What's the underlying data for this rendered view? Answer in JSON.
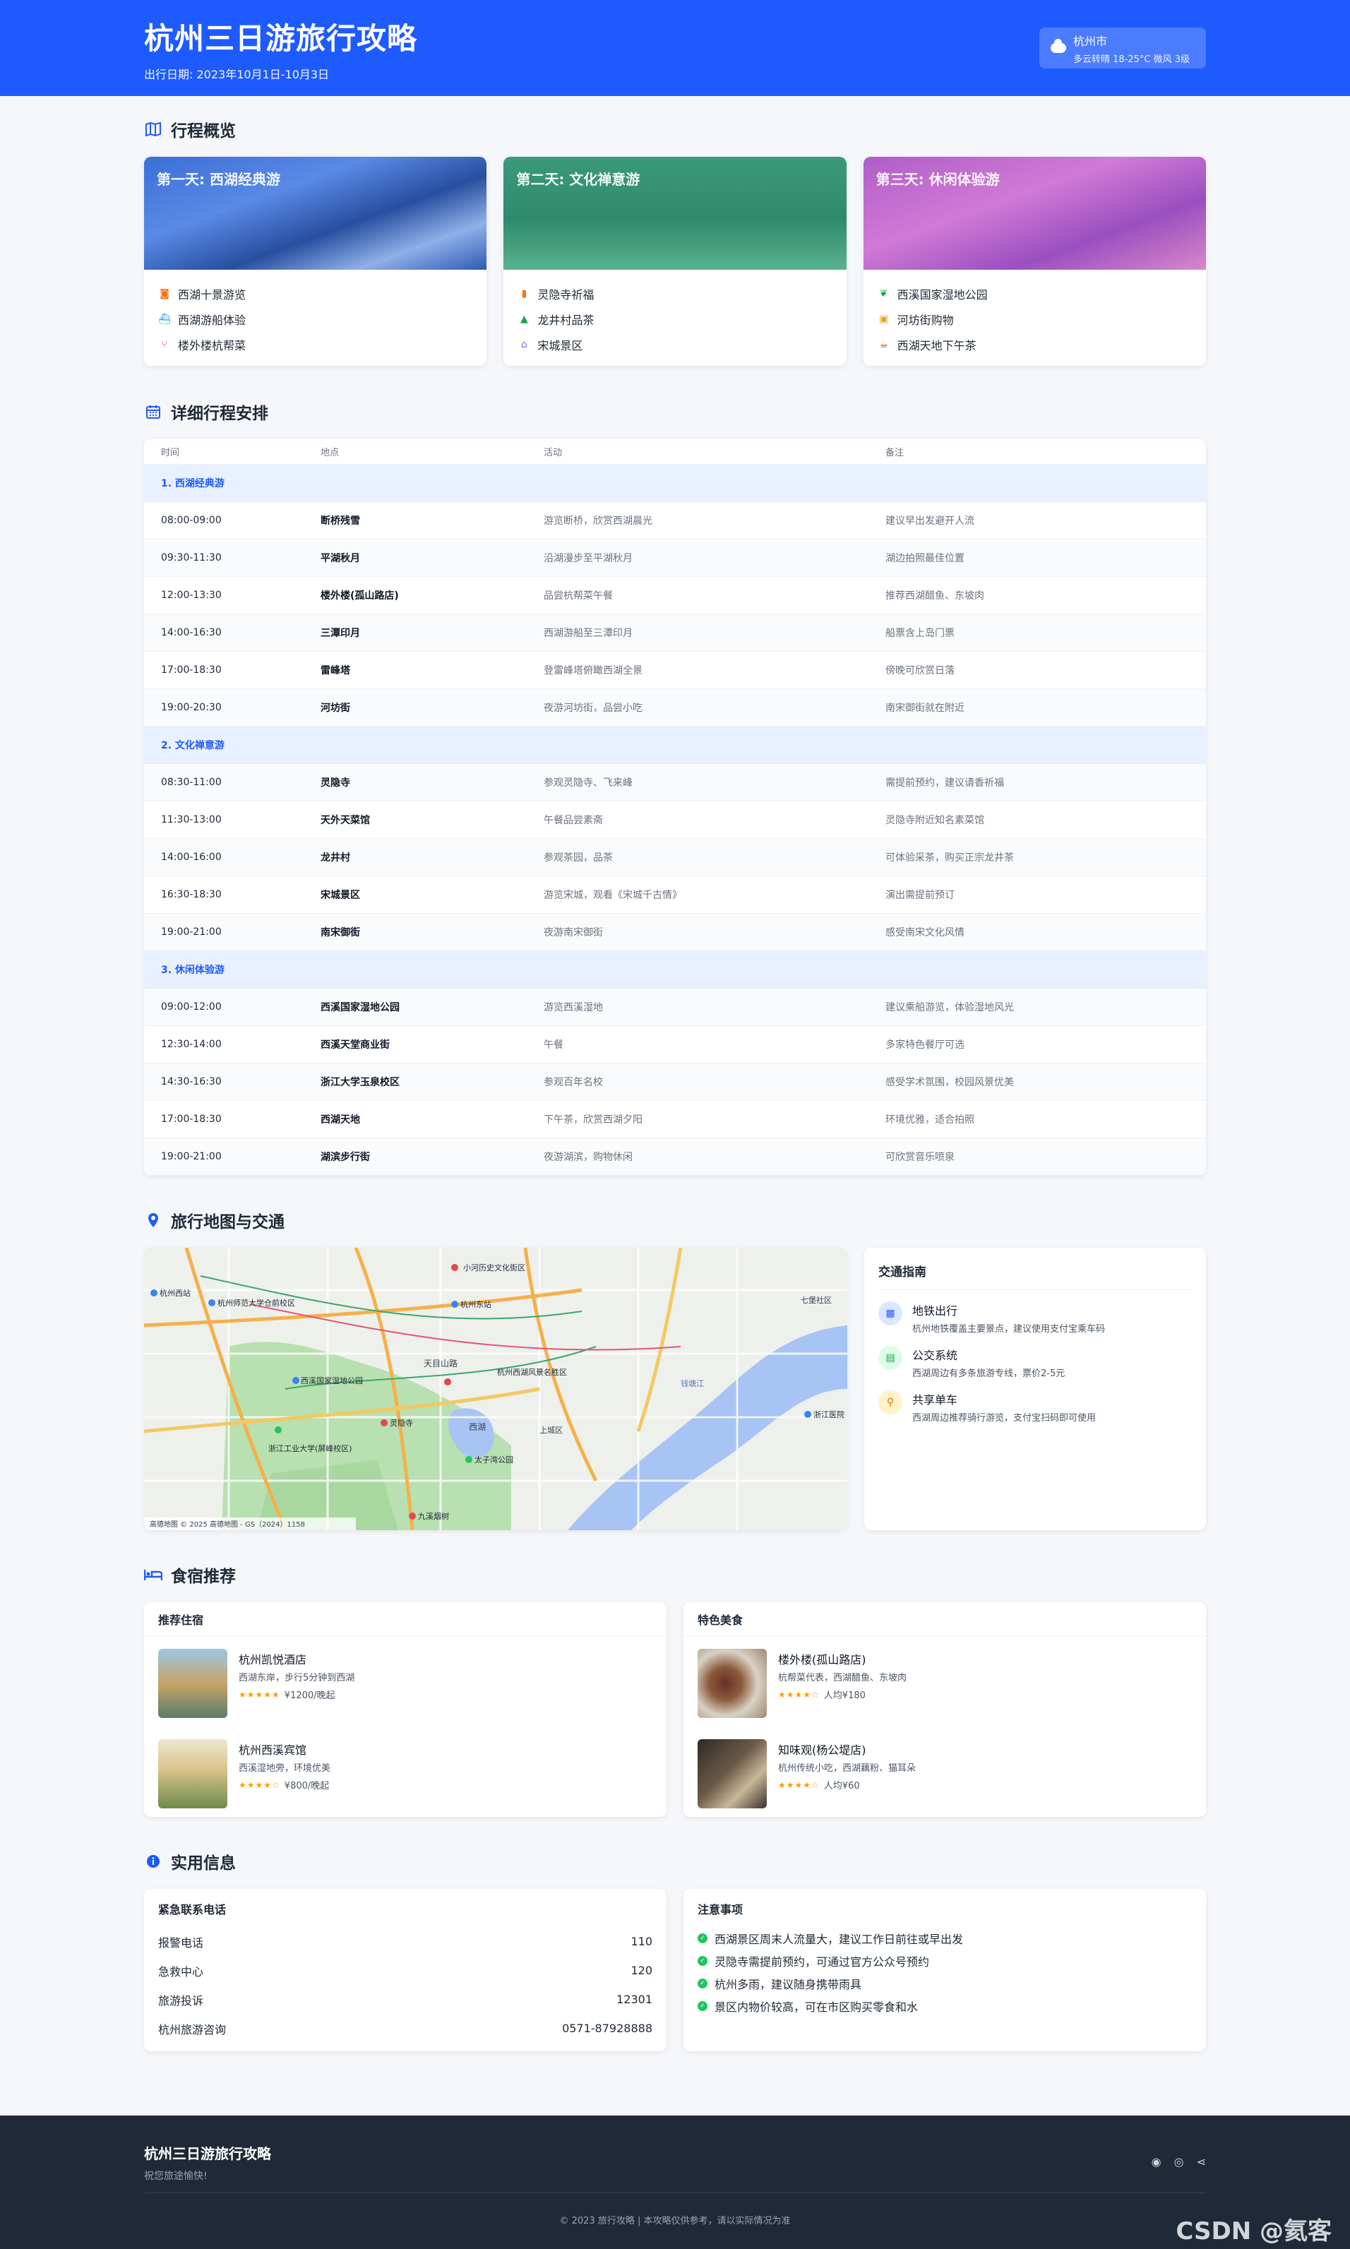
{
  "header": {
    "title": "杭州三日游旅行攻略",
    "subtitle": "出行日期: 2023年10月1日-10月3日",
    "weather": {
      "city": "杭州市",
      "desc": "多云转晴 18-25°C 微风 3级"
    }
  },
  "overview": {
    "title": "行程概览",
    "cards": [
      {
        "label": "第一天: 西湖经典游",
        "items": [
          "西湖十景游览",
          "西湖游船体验",
          "楼外楼杭帮菜"
        ],
        "icons": [
          "camera-icon",
          "ship-icon",
          "utensils-icon"
        ]
      },
      {
        "label": "第二天: 文化禅意游",
        "items": [
          "灵隐寺祈福",
          "龙井村品茶",
          "宋城景区"
        ],
        "icons": [
          "book-icon",
          "tree-icon",
          "temple-icon"
        ]
      },
      {
        "label": "第三天: 休闲体验游",
        "items": [
          "西溪国家湿地公园",
          "河坊街购物",
          "西湖天地下午茶"
        ],
        "icons": [
          "leaf-icon",
          "shopping-bag-icon",
          "coffee-icon"
        ]
      }
    ]
  },
  "schedule": {
    "title": "详细行程安排",
    "columns": [
      "时间",
      "地点",
      "活动",
      "备注"
    ],
    "groups": [
      {
        "name": "1. 西湖经典游",
        "rows": [
          [
            "08:00-09:00",
            "断桥残雪",
            "游览断桥，欣赏西湖晨光",
            "建议早出发避开人流"
          ],
          [
            "09:30-11:30",
            "平湖秋月",
            "沿湖漫步至平湖秋月",
            "湖边拍照最佳位置"
          ],
          [
            "12:00-13:30",
            "楼外楼(孤山路店)",
            "品尝杭帮菜午餐",
            "推荐西湖醋鱼、东坡肉"
          ],
          [
            "14:00-16:30",
            "三潭印月",
            "西湖游船至三潭印月",
            "船票含上岛门票"
          ],
          [
            "17:00-18:30",
            "雷峰塔",
            "登雷峰塔俯瞰西湖全景",
            "傍晚可欣赏日落"
          ],
          [
            "19:00-20:30",
            "河坊街",
            "夜游河坊街，品尝小吃",
            "南宋御街就在附近"
          ]
        ]
      },
      {
        "name": "2. 文化禅意游",
        "rows": [
          [
            "08:30-11:00",
            "灵隐寺",
            "参观灵隐寺、飞来峰",
            "需提前预约，建议请香祈福"
          ],
          [
            "11:30-13:00",
            "天外天菜馆",
            "午餐品尝素斋",
            "灵隐寺附近知名素菜馆"
          ],
          [
            "14:00-16:00",
            "龙井村",
            "参观茶园，品茶",
            "可体验采茶，购买正宗龙井茶"
          ],
          [
            "16:30-18:30",
            "宋城景区",
            "游览宋城，观看《宋城千古情》",
            "演出需提前预订"
          ],
          [
            "19:00-21:00",
            "南宋御街",
            "夜游南宋御街",
            "感受南宋文化风情"
          ]
        ]
      },
      {
        "name": "3. 休闲体验游",
        "rows": [
          [
            "09:00-12:00",
            "西溪国家湿地公园",
            "游览西溪湿地",
            "建议乘船游览，体验湿地风光"
          ],
          [
            "12:30-14:00",
            "西溪天堂商业街",
            "午餐",
            "多家特色餐厅可选"
          ],
          [
            "14:30-16:30",
            "浙江大学玉泉校区",
            "参观百年名校",
            "感受学术氛围，校园风景优美"
          ],
          [
            "17:00-18:30",
            "西湖天地",
            "下午茶，欣赏西湖夕阳",
            "环境优雅，适合拍照"
          ],
          [
            "19:00-21:00",
            "湖滨步行街",
            "夜游湖滨，购物休闲",
            "可欣赏音乐喷泉"
          ]
        ]
      }
    ]
  },
  "map": {
    "title": "旅行地图与交通",
    "labels": [
      "杭州西站",
      "杭州师范大学仓前校区",
      "小河历史文化街区",
      "杭州东站",
      "天目山路",
      "西溪国家湿地公园",
      "西湖",
      "杭州西湖风景名胜区",
      "灵隐寺",
      "浙江工业大学(屏峰校区)",
      "太子湾公园",
      "九溪烟树",
      "钱塘江",
      "浙江医院",
      "上城区",
      "七堡社区"
    ],
    "credit": "高德地图 © 2025 高德地图 - GS（2024）1158"
  },
  "traffic": {
    "title": "交通指南",
    "items": [
      {
        "name": "地铁出行",
        "desc": "杭州地铁覆盖主要景点，建议使用支付宝乘车码",
        "icon": "subway-icon"
      },
      {
        "name": "公交系统",
        "desc": "西湖周边有多条旅游专线，票价2-5元",
        "icon": "bus-icon"
      },
      {
        "name": "共享单车",
        "desc": "西湖周边推荐骑行游览，支付宝扫码即可使用",
        "icon": "bicycle-icon"
      }
    ]
  },
  "stay": {
    "title": "食宿推荐",
    "hotels": {
      "heading": "推荐住宿",
      "items": [
        {
          "name": "杭州凯悦酒店",
          "desc": "西湖东岸，步行5分钟到西湖",
          "rating": 4.5,
          "stars": "★★★★★",
          "price": "¥1200/晚起"
        },
        {
          "name": "杭州西溪宾馆",
          "desc": "西溪湿地旁，环境优美",
          "rating": 4,
          "stars": "★★★★☆",
          "price": "¥800/晚起"
        }
      ]
    },
    "food": {
      "heading": "特色美食",
      "items": [
        {
          "name": "楼外楼(孤山路店)",
          "desc": "杭帮菜代表，西湖醋鱼、东坡肉",
          "rating": 4,
          "stars": "★★★★☆",
          "price": "人均¥180"
        },
        {
          "name": "知味观(杨公堤店)",
          "desc": "杭州传统小吃，西湖藕粉、猫耳朵",
          "rating": 3.5,
          "stars": "★★★★☆",
          "price": "人均¥60"
        }
      ]
    }
  },
  "practical": {
    "title": "实用信息",
    "contacts": {
      "heading": "紧急联系电话",
      "items": [
        {
          "k": "报警电话",
          "v": "110"
        },
        {
          "k": "急救中心",
          "v": "120"
        },
        {
          "k": "旅游投诉",
          "v": "12301"
        },
        {
          "k": "杭州旅游咨询",
          "v": "0571-87928888"
        }
      ]
    },
    "notes": {
      "heading": "注意事项",
      "items": [
        "西湖景区周末人流量大，建议工作日前往或早出发",
        "灵隐寺需提前预约，可通过官方公众号预约",
        "杭州多雨，建议随身携带雨具",
        "景区内物价较高，可在市区购买零食和水"
      ]
    }
  },
  "footer": {
    "title": "杭州三日游旅行攻略",
    "subtitle": "祝您旅途愉快!",
    "copyright": "© 2023 旅行攻略 | 本攻略仅供参考，请以实际情况为准",
    "watermark": "CSDN @氦客"
  },
  "colors": {
    "primary": "#1e5bff",
    "footer": "#1f2937",
    "group_bg": "#e9f0ff",
    "star": "#f59e0b",
    "check": "#22c55e"
  }
}
